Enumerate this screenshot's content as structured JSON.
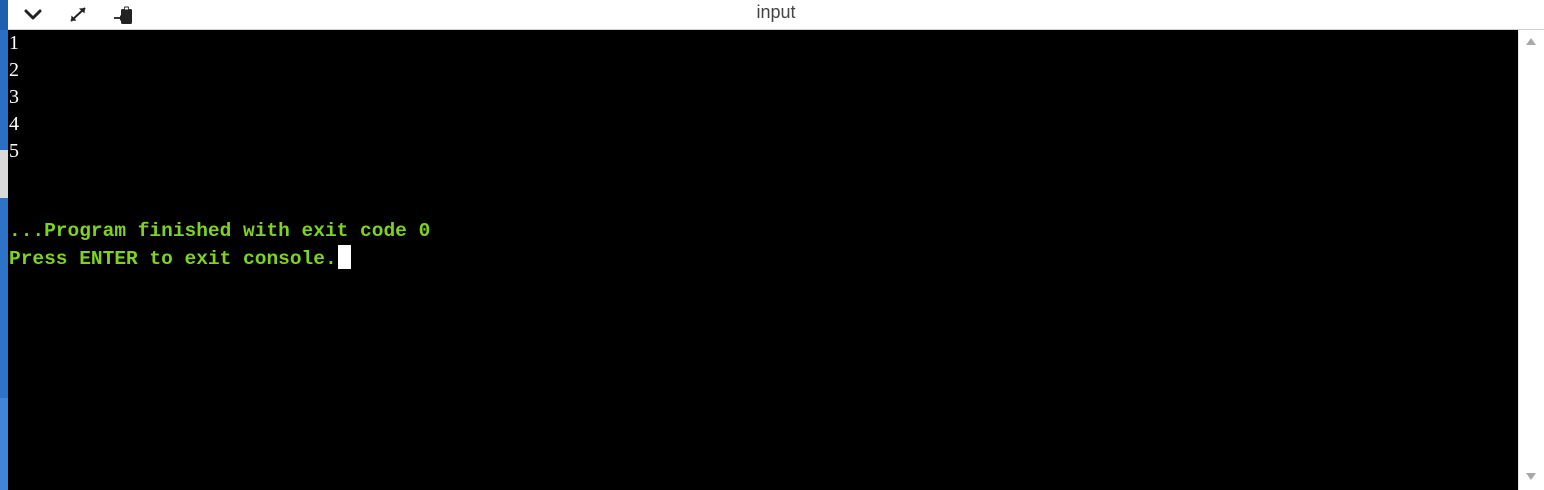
{
  "window": {
    "title": "input"
  },
  "toolbar": {
    "buttons": [
      {
        "icon": "chevron-down-icon"
      },
      {
        "icon": "expand-icon"
      },
      {
        "icon": "paste-clipboard-icon"
      }
    ]
  },
  "console": {
    "output_lines": [
      "1",
      "2",
      "3",
      "4",
      "5"
    ],
    "exit_message": "...Program finished with exit code 0",
    "prompt_message": "Press ENTER to exit console.",
    "text_color": "#ffffff",
    "status_color": "#7ed321",
    "background": "#000000"
  }
}
